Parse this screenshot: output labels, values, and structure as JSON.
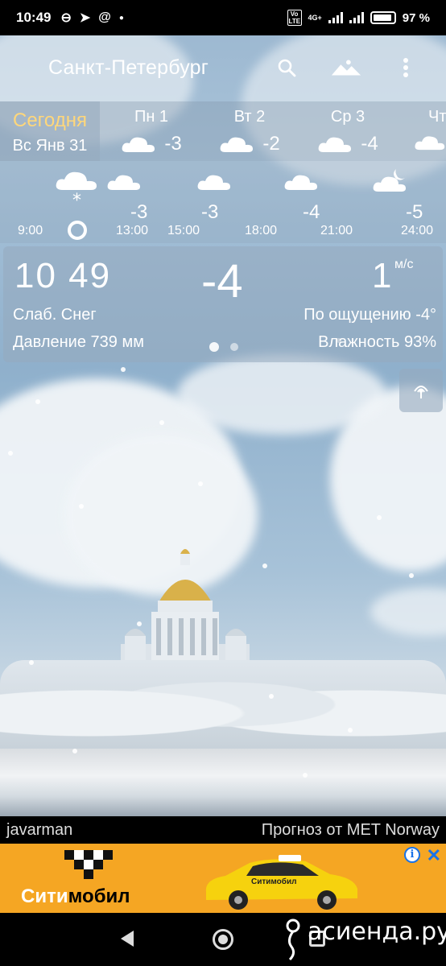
{
  "status_bar": {
    "time": "10:49",
    "network": "4G+",
    "volte": "Vo LTE",
    "battery": "97 %"
  },
  "app_bar": {
    "city": "Санкт-Петербург",
    "icons": [
      "search-icon",
      "landscape-icon",
      "more-vert-icon"
    ]
  },
  "daily": {
    "today_label": "Сегодня",
    "today_date": "Вс Янв 31",
    "days": [
      {
        "name": "Пн 1",
        "temp": "-3",
        "icon": "cloud-icon"
      },
      {
        "name": "Вт 2",
        "temp": "-2",
        "icon": "cloud-icon"
      },
      {
        "name": "Ср 3",
        "temp": "-4",
        "icon": "cloud-icon"
      },
      {
        "name": "Чт",
        "temp": "",
        "icon": "cloud-icon"
      }
    ]
  },
  "hourly": {
    "items": [
      {
        "time": "9:00",
        "temp": "",
        "icon": "snow-cloud-icon"
      },
      {
        "time": "13:00",
        "temp": "-3",
        "icon": "cloud-icon"
      },
      {
        "time": "15:00",
        "temp": "-3",
        "icon": "cloud-icon"
      },
      {
        "time": "18:00",
        "temp": "-4",
        "icon": "cloud-icon"
      },
      {
        "time": "21:00",
        "temp": "",
        "icon": ""
      },
      {
        "time": "24:00",
        "temp": "-5",
        "icon": "cloud-moon-icon"
      }
    ]
  },
  "current": {
    "time": "10  49",
    "temp": "-4",
    "wind": "1",
    "wind_unit": "м/с",
    "condition": "Слаб. Снег",
    "feels_like": "По ощущению -4°",
    "pressure": "Давление 739 мм",
    "humidity": "Влажность 93%",
    "page_index": 0,
    "page_count": 2
  },
  "credits": {
    "photo_author": "javarman",
    "provider": "Прогноз от MET Norway"
  },
  "ad": {
    "brand_part1": "Сити",
    "brand_part2": "мобил",
    "car_label": "Ситимобил",
    "info_icon": "info-icon",
    "close_icon": "close-icon"
  },
  "watermark": {
    "text": "асиенда.ру"
  },
  "colors": {
    "today_accent": "#ffd77a",
    "ad_background": "#f5a623",
    "ad_controls": "#1a73e8"
  }
}
